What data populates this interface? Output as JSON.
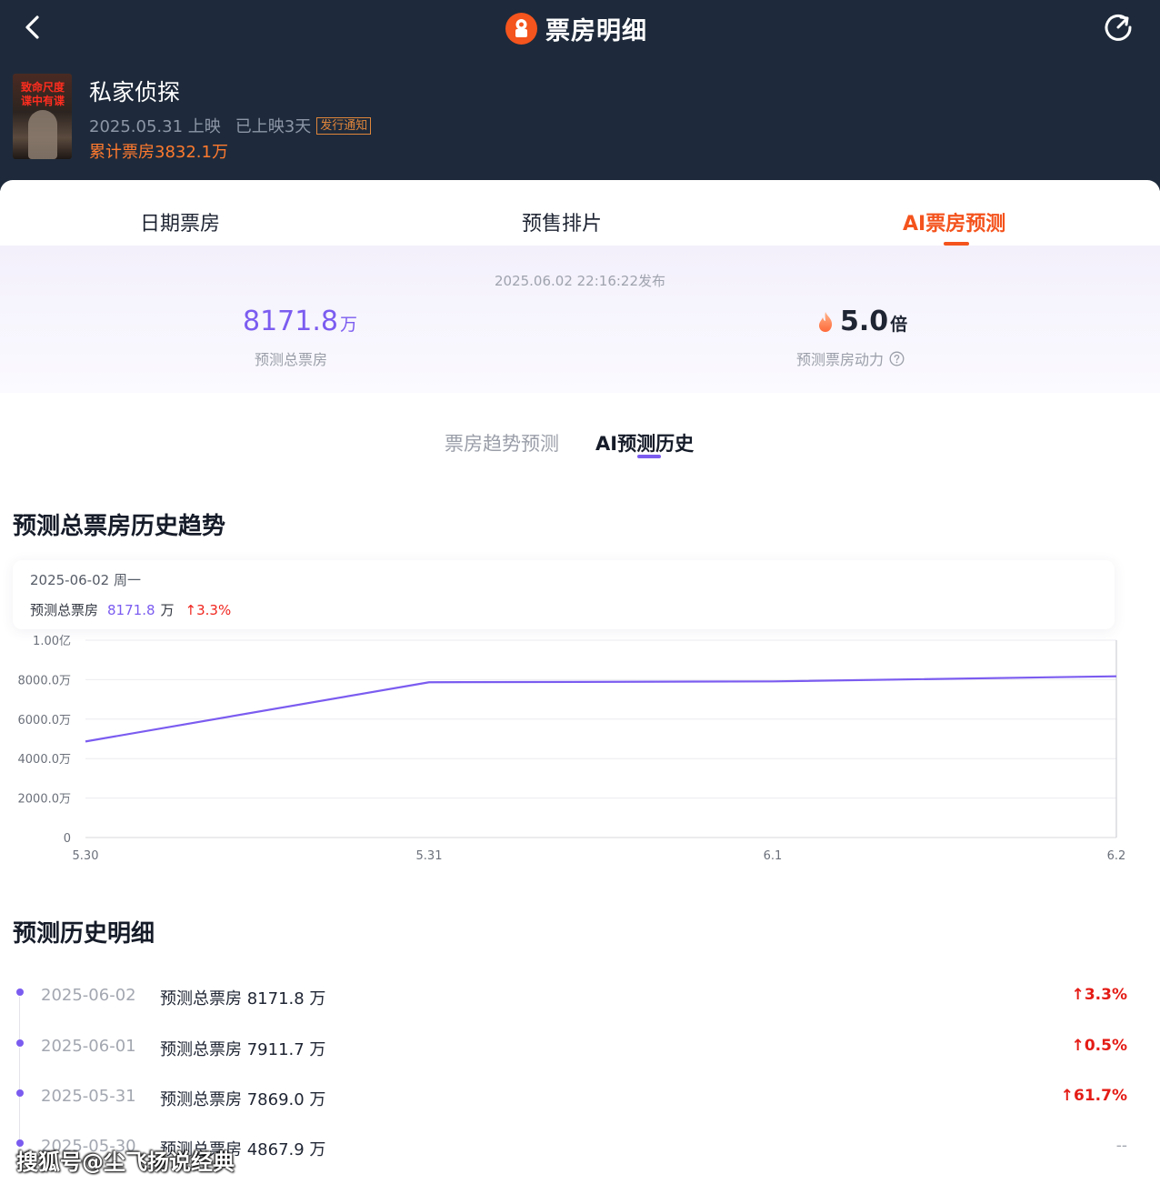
{
  "header": {
    "title": "票房明细"
  },
  "movie": {
    "poster_text": "致命尺度 谍中有谍",
    "name": "私家侦探",
    "release": "2025.05.31 上映",
    "days": "已上映3天",
    "notice_tag": "发行通知",
    "cumulative": "累计票房3832.1万"
  },
  "tabs": [
    {
      "label": "日期票房",
      "active": false
    },
    {
      "label": "预售排片",
      "active": false
    },
    {
      "label": "AI票房预测",
      "active": true
    }
  ],
  "forecast": {
    "publish_time": "2025.06.02 22:16:22发布",
    "total_value": "8171.8",
    "total_unit": "万",
    "total_label": "预测总票房",
    "power_value": "5.0",
    "power_unit": "倍",
    "power_label": "预测票房动力"
  },
  "sub_tabs": [
    {
      "label": "票房趋势预测",
      "active": false
    },
    {
      "label": "AI预测历史",
      "active": true
    }
  ],
  "trend_section": {
    "title": "预测总票房历史趋势"
  },
  "tooltip": {
    "date": "2025-06-02  周一",
    "label": "预测总票房",
    "value": "8171.8",
    "unit": "万",
    "change": "↑3.3%"
  },
  "chart_data": {
    "type": "line",
    "x": [
      "5.30",
      "5.31",
      "6.1",
      "6.2"
    ],
    "series": [
      {
        "values": [
          4867.9,
          7869.0,
          7911.7,
          8171.8
        ]
      }
    ],
    "y_ticks": [
      "1.00亿",
      "8000.0万",
      "6000.0万",
      "4000.0万",
      "2000.0万",
      "0"
    ],
    "ylim": [
      0,
      10000
    ],
    "grid": true,
    "line_color": "#7b5cf0"
  },
  "history_section": {
    "title": "预测历史明细"
  },
  "history": [
    {
      "date": "2025-06-02",
      "label": "预测总票房 8171.8 万",
      "change": "↑3.3%"
    },
    {
      "date": "2025-06-01",
      "label": "预测总票房 7911.7 万",
      "change": "↑0.5%"
    },
    {
      "date": "2025-05-31",
      "label": "预测总票房 7869.0 万",
      "change": "↑61.7%"
    },
    {
      "date": "2025-05-30",
      "label": "预测总票房 4867.9 万",
      "change": "--"
    }
  ],
  "watermark": "搜狐号@尘飞扬说经典"
}
